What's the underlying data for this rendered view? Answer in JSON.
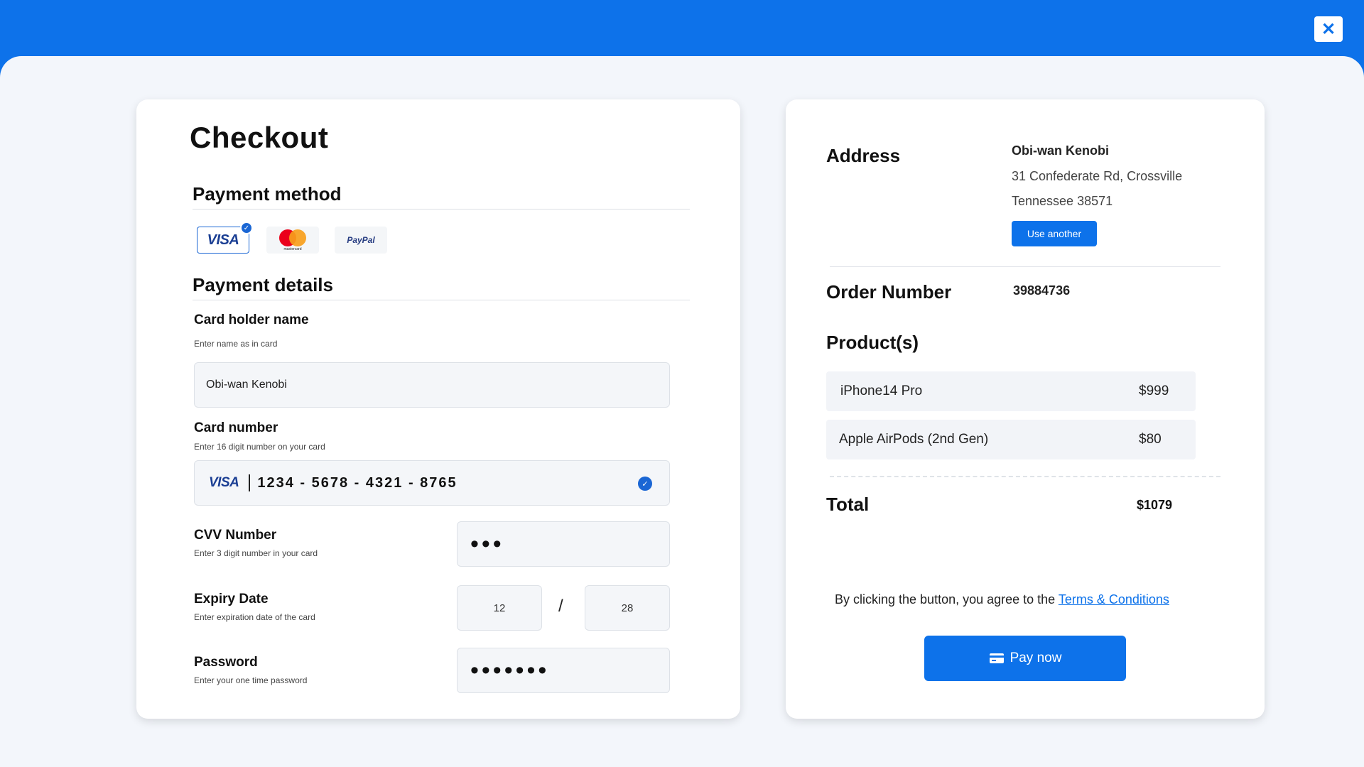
{
  "topbar": {
    "close_icon": "close-icon",
    "close_glyph": "✕"
  },
  "checkout": {
    "title": "Checkout",
    "payment_method_title": "Payment method",
    "payment_options": [
      {
        "name": "VISA",
        "selected": true
      },
      {
        "name": "mastercard",
        "selected": false
      },
      {
        "name": "PayPal",
        "selected": false
      }
    ],
    "payment_details_title": "Payment details",
    "cardholder": {
      "label": "Card holder name",
      "hint": "Enter name as in card",
      "value": "Obi-wan Kenobi"
    },
    "card_number": {
      "label": "Card number",
      "hint": "Enter 16 digit number on your card",
      "brand": "VISA",
      "value": "1234 - 5678 - 4321 - 8765"
    },
    "cvv": {
      "label": "CVV Number",
      "hint": "Enter 3 digit number in your card",
      "value": "•••"
    },
    "expiry": {
      "label": "Expiry Date",
      "hint": "Enter expiration date of the card",
      "month": "12",
      "separator": "/",
      "year": "28"
    },
    "password": {
      "label": "Password",
      "hint": "Enter your one time password",
      "value": "•••••••"
    }
  },
  "summary": {
    "address_title": "Address",
    "address_name": "Obi-wan Kenobi",
    "address_line1": "31 Confederate Rd, Crossville",
    "address_line2": "Tennessee 38571",
    "use_another_label": "Use another",
    "order_number_title": "Order Number",
    "order_number": "39884736",
    "products_title": "Product(s)",
    "products": [
      {
        "name": "iPhone14 Pro",
        "price": "$999"
      },
      {
        "name": "Apple AirPods (2nd Gen)",
        "price": "$80"
      }
    ],
    "total_title": "Total",
    "total": "$1079",
    "terms_prefix": "By clicking the button, you agree to the ",
    "terms_link": "Terms & Conditions",
    "pay_label": "Pay now"
  },
  "colors": {
    "brand_blue": "#0d72ea",
    "background": "#f3f6fb"
  }
}
